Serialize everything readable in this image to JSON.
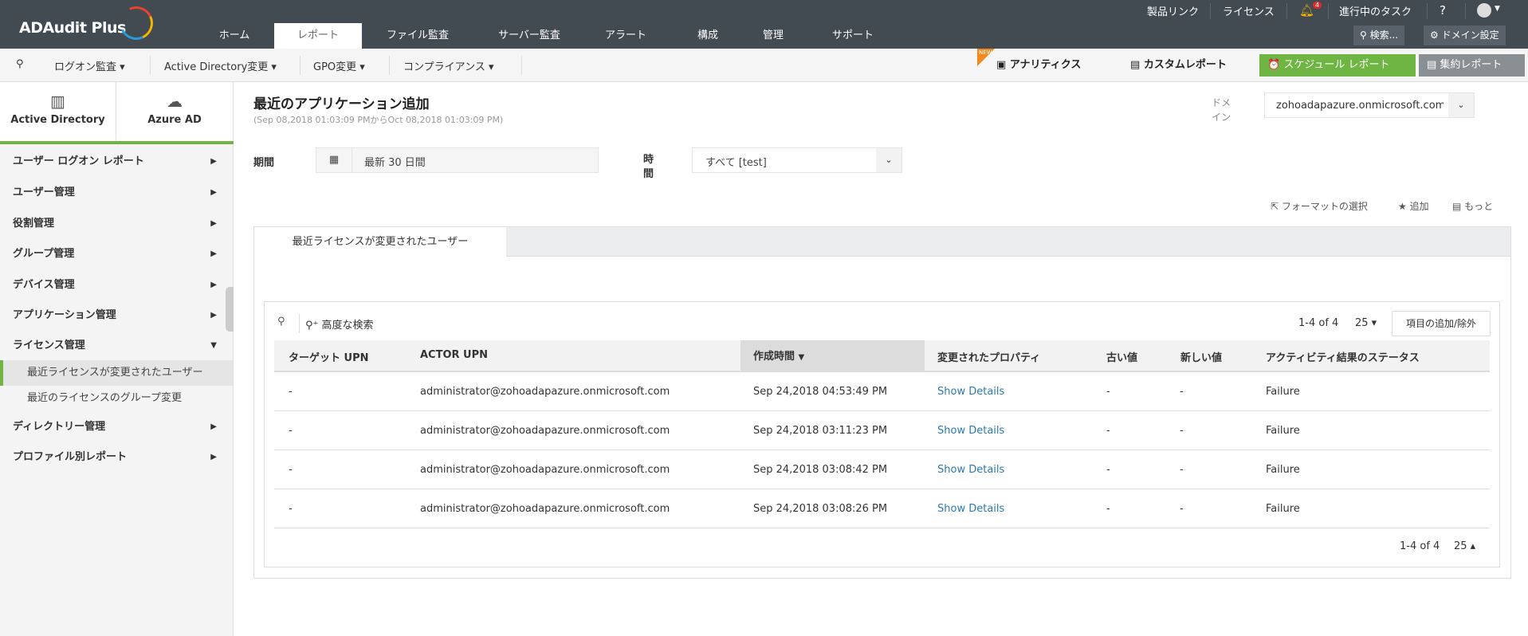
{
  "app": {
    "logo": "ADAudit Plus"
  },
  "header": {
    "nav": [
      "ホーム",
      "レポート",
      "ファイル監査",
      "サーバー監査",
      "アラート",
      "構成",
      "管理",
      "サポート"
    ],
    "active_nav": "レポート",
    "top_links": [
      "製品リンク",
      "ライセンス",
      "進行中のタスク",
      "?"
    ],
    "notification_count": "4",
    "search_label": "検索...",
    "domain_settings_label": "ドメイン設定"
  },
  "toolbar": {
    "menus": [
      "ログオン監査",
      "Active Directory変更",
      "GPO変更",
      "コンプライアンス"
    ],
    "new_badge": "NEW",
    "analytics": "アナリティクス",
    "custom_report": "カスタムレポート",
    "schedule_report": "スケジュール レポート",
    "summary_report": "集約レポート"
  },
  "sidebar": {
    "tabs": [
      "Active Directory",
      "Azure AD"
    ],
    "items": [
      "ユーザー ログオン レポート",
      "ユーザー管理",
      "役割管理",
      "グループ管理",
      "デバイス管理",
      "アプリケーション管理",
      "ライセンス管理"
    ],
    "subitems": [
      "最近ライセンスが変更されたユーザー",
      "最近のライセンスのグループ変更"
    ],
    "items_after": [
      "ディレクトリー管理",
      "プロファイル別レポート"
    ]
  },
  "report": {
    "title": "最近のアプリケーション追加",
    "range": "(Sep 08,2018 01:03:09 PMからOct 08,2018 01:03:09 PM)",
    "domain_label": "ドメイン",
    "domain_value": "zohoadapazure.onmicrosoft.com",
    "period_label": "期間",
    "period_value": "最新 30 日間",
    "time_label": "時間",
    "time_value": "すべて [test]",
    "actions": [
      "フォーマットの選択",
      "追加",
      "もっと"
    ],
    "tab": "最近ライセンスが変更されたユーザー"
  },
  "table": {
    "advanced_search": "高度な検索",
    "pagination": "1-4 of 4",
    "page_size": "25",
    "add_remove_columns": "項目の追加/除外",
    "columns": [
      "ターゲット UPN",
      "ACTOR UPN",
      "作成時間",
      "変更されたプロパティ",
      "古い値",
      "新しい値",
      "アクティビティ結果のステータス"
    ],
    "rows": [
      [
        "-",
        "administrator@zohoadapazure.onmicrosoft.com",
        "Sep 24,2018 04:53:49 PM",
        "Show Details",
        "-",
        "-",
        "Failure"
      ],
      [
        "-",
        "administrator@zohoadapazure.onmicrosoft.com",
        "Sep 24,2018 03:11:23 PM",
        "Show Details",
        "-",
        "-",
        "Failure"
      ],
      [
        "-",
        "administrator@zohoadapazure.onmicrosoft.com",
        "Sep 24,2018 03:08:42 PM",
        "Show Details",
        "-",
        "-",
        "Failure"
      ],
      [
        "-",
        "administrator@zohoadapazure.onmicrosoft.com",
        "Sep 24,2018 03:08:26 PM",
        "Show Details",
        "-",
        "-",
        "Failure"
      ]
    ]
  },
  "colors": {
    "header": "#424a52",
    "accent_green": "#6fb543",
    "link": "#2a7ab0"
  }
}
